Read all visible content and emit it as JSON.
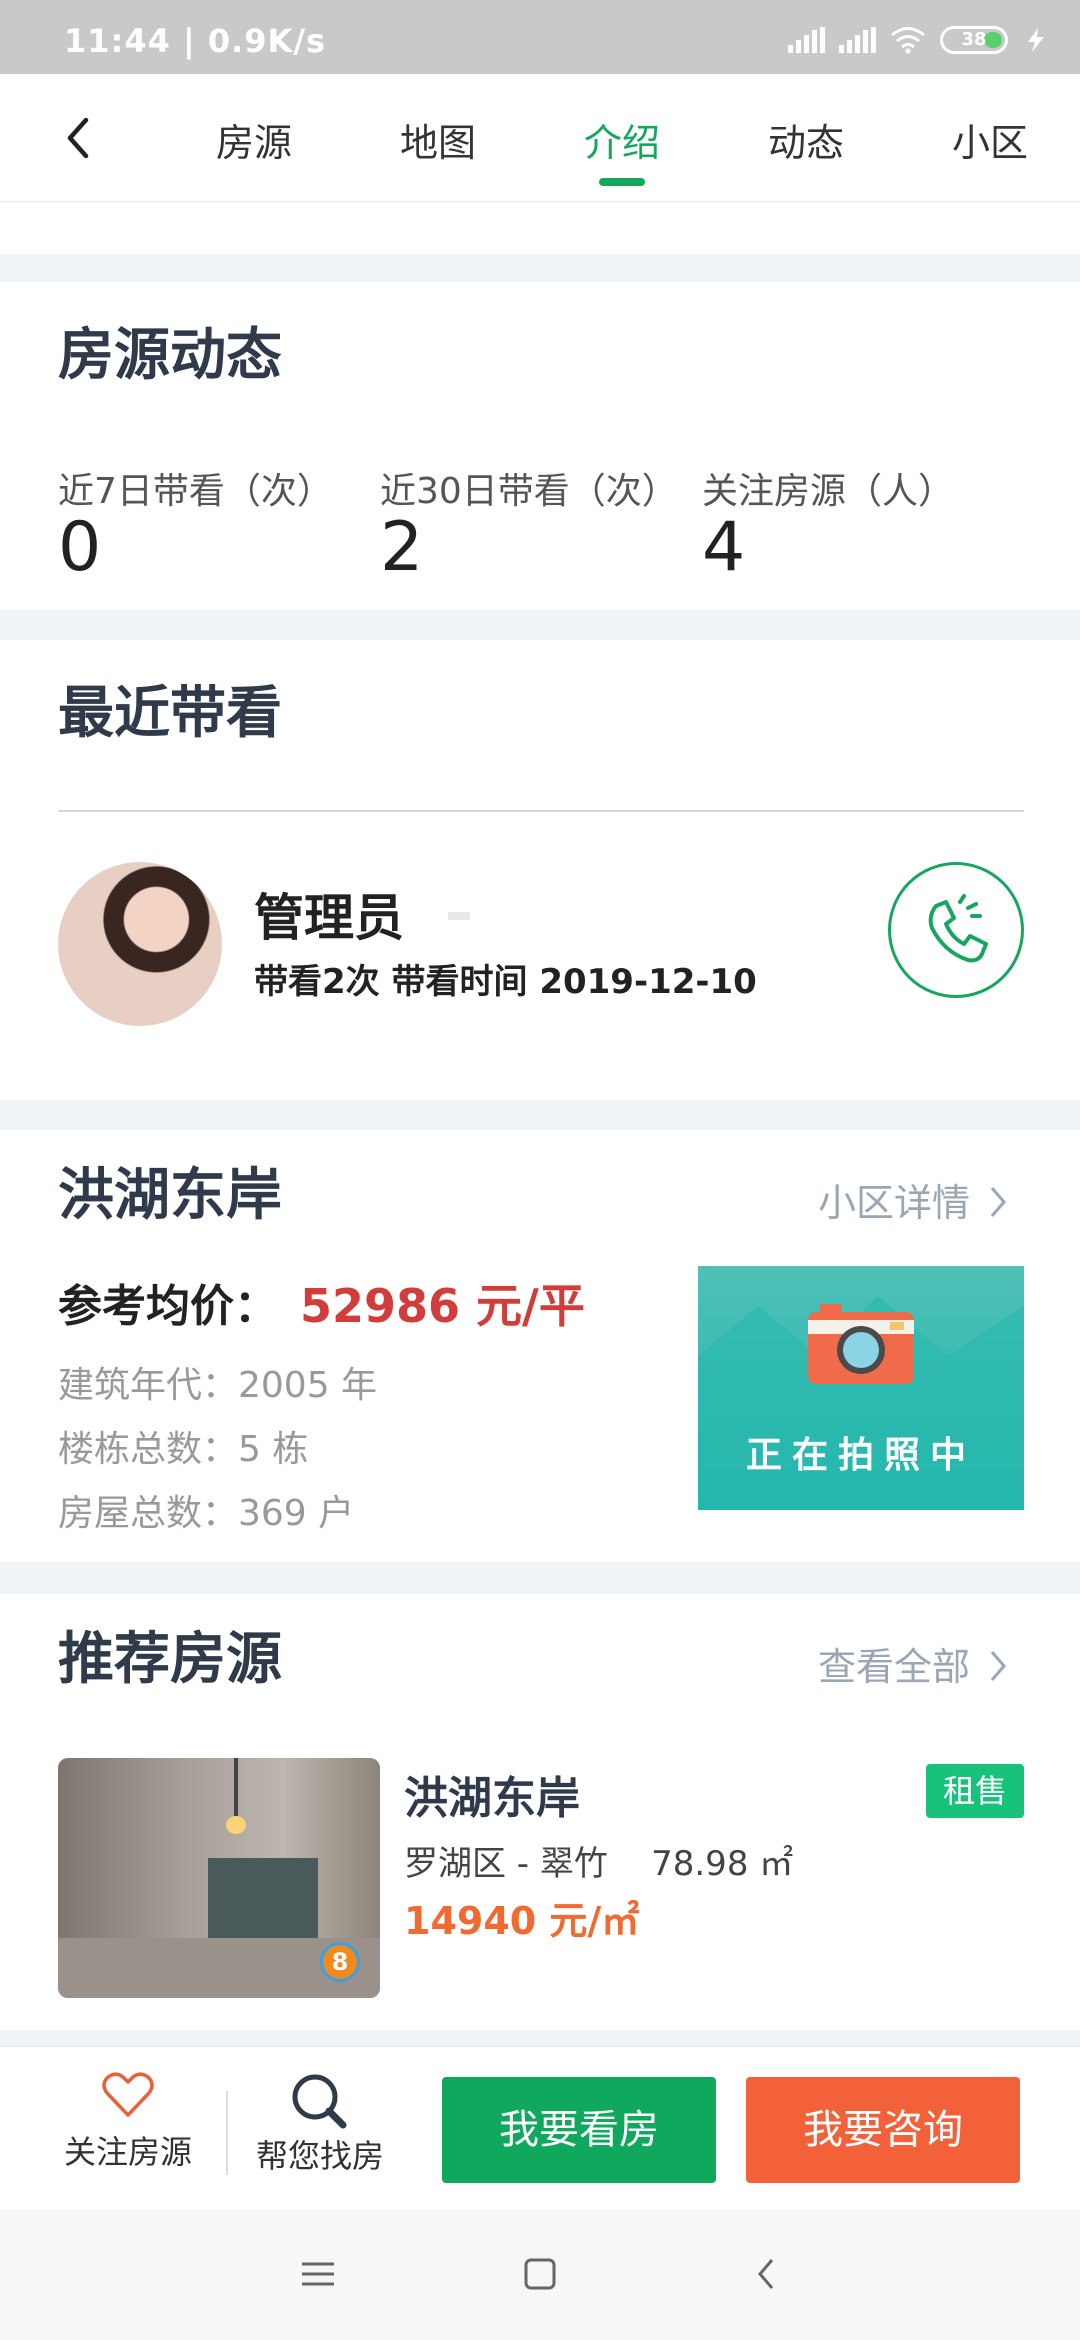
{
  "status_bar": {
    "time": "11:44 | 0.9K/s",
    "battery": "38"
  },
  "nav": {
    "tabs": [
      {
        "label": "房源"
      },
      {
        "label": "地图"
      },
      {
        "label": "介绍"
      },
      {
        "label": "动态"
      },
      {
        "label": "小区"
      }
    ],
    "active_tab": "介绍"
  },
  "listing_activity": {
    "title": "房源动态",
    "stats": [
      {
        "label": "近7日带看（次）",
        "value": "0"
      },
      {
        "label": "近30日带看（次）",
        "value": "2"
      },
      {
        "label": "关注房源（人）",
        "value": "4"
      }
    ]
  },
  "recent_viewing": {
    "title": "最近带看",
    "agent": {
      "name": "管理员",
      "info": "带看2次 带看时间 2019-12-10"
    }
  },
  "community": {
    "name": "洪湖东岸",
    "detail_link": "小区详情",
    "price_label": "参考均价：",
    "price_value": "52986 元/平",
    "info": [
      "建筑年代：2005 年",
      "楼栋总数：5 栋",
      "房屋总数：369 户"
    ],
    "photo_text": "正在拍照中"
  },
  "recommended": {
    "title": "推荐房源",
    "more_link": "查看全部",
    "listing": {
      "title": "洪湖东岸",
      "badge": "租售",
      "area": "罗湖区 - 翠竹    78.98 ㎡",
      "price": "14940 元/㎡",
      "thumb_badge": "8"
    }
  },
  "action_bar": {
    "follow_label": "关注房源",
    "find_label": "帮您找房",
    "view_button": "我要看房",
    "consult_button": "我要咨询"
  },
  "colors": {
    "accent": "#15a85c",
    "price_red": "#d23c3a",
    "orange": "#f3613a",
    "badge_green": "#19c27b"
  }
}
